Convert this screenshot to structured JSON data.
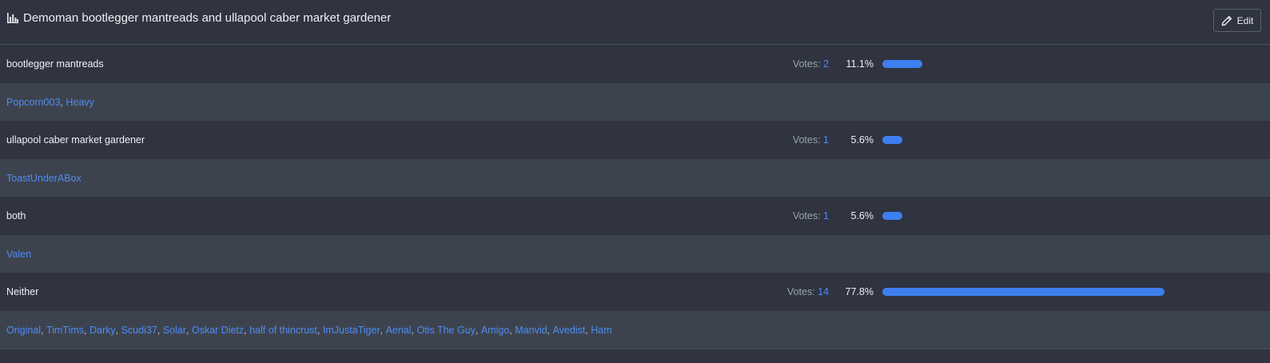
{
  "poll": {
    "title": "Demoman bootlegger mantreads and ullapool caber market gardener",
    "edit_label": "Edit",
    "votes_prefix": "Votes: ",
    "options": [
      {
        "label": "bootlegger mantreads",
        "votes": "2",
        "percent": "11.1%",
        "fraction": 0.111,
        "voters": [
          "Popcorn003",
          "Heavy"
        ]
      },
      {
        "label": "ullapool caber market gardener",
        "votes": "1",
        "percent": "5.6%",
        "fraction": 0.056,
        "voters": [
          "ToastUnderABox"
        ]
      },
      {
        "label": "both",
        "votes": "1",
        "percent": "5.6%",
        "fraction": 0.056,
        "voters": [
          "Valen"
        ]
      },
      {
        "label": "Neither",
        "votes": "14",
        "percent": "77.8%",
        "fraction": 0.778,
        "voters": [
          "Original",
          "TimTims",
          "Darky",
          "Scudi37",
          "Solar",
          "Oskar Dietz",
          "half of thincrust",
          "ImJustaTiger",
          "Aerial",
          "Otis The Guy",
          "Amigo",
          "Manvid",
          "Avedist",
          "Ham"
        ]
      }
    ]
  },
  "icons": {
    "title_icon": "bar-chart-icon",
    "edit_icon": "pencil-icon"
  },
  "colors": {
    "background": "#2f3440",
    "voter_row_background": "#3d434e",
    "accent": "#3e7ff0",
    "link": "#4d8cf5"
  }
}
